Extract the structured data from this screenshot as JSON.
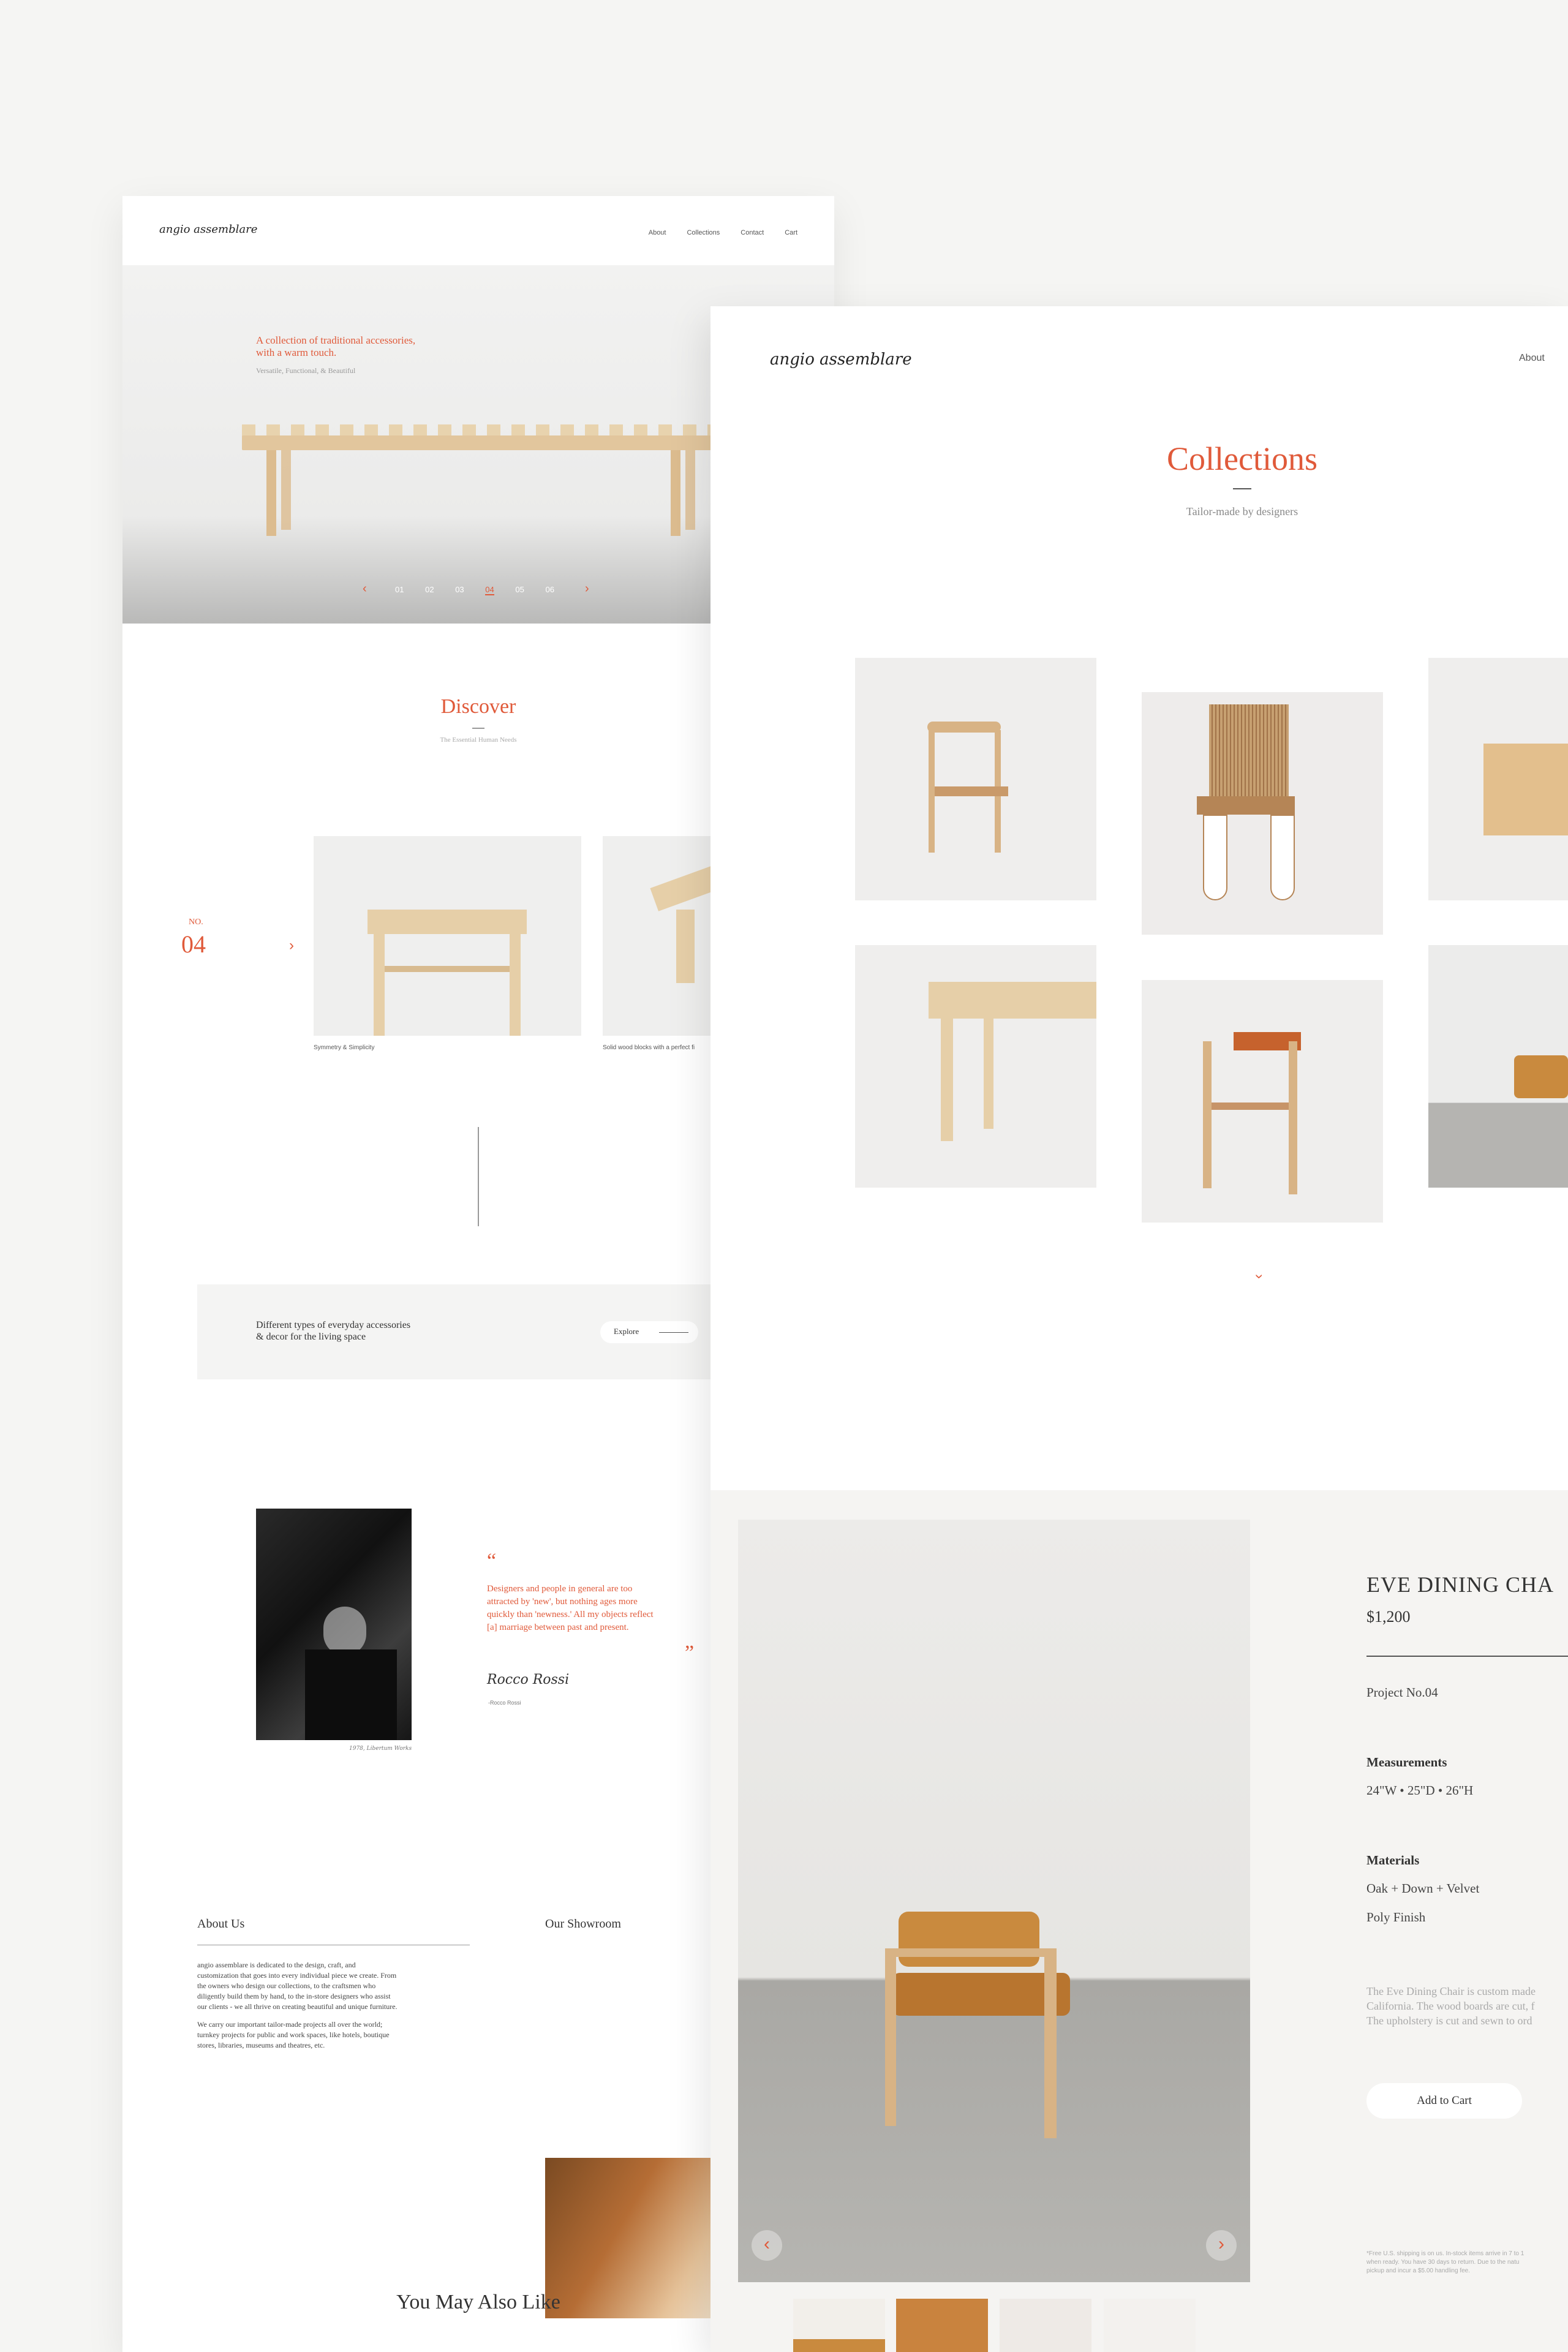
{
  "left": {
    "logo": "angio assemblare",
    "nav": [
      "About",
      "Collections",
      "Contact",
      "Cart"
    ],
    "hero": {
      "headline_line1": "A collection of traditional accessories,",
      "headline_line2": "with a warm touch.",
      "subtitle": "Versatile, Functional, & Beautiful",
      "slides": [
        "01",
        "02",
        "03",
        "04",
        "05",
        "06"
      ],
      "active_slide": "04"
    },
    "discover": {
      "title": "Discover",
      "subtitle": "The Essential Human Needs",
      "no_label": "NO.",
      "number": "04",
      "captions": [
        "Symmetry & Simplicity",
        "Solid wood blocks with a perfect fi"
      ]
    },
    "banner": {
      "line1": "Different types of everyday accessories",
      "line2": "& decor for the living space",
      "button": "Explore"
    },
    "quote": {
      "open": "“",
      "close": "”",
      "line1": "Designers and people in general are too",
      "line2": "attracted by 'new', but nothing ages more",
      "line3": "quickly than 'newness.' All my objects reflect",
      "line4": "[a] marriage between past and present.",
      "signature": "Rocco Rossi",
      "author": "-Rocco Rossi",
      "photo_caption": "1978, Libertum Works"
    },
    "about": {
      "title": "About Us",
      "p1_lines": [
        "angio assemblare is dedicated to the design, craft, and",
        "customization that goes into every individual piece we create. From",
        "the owners who design our collections, to the craftsmen who",
        "diligently build them by hand, to the in-store designers who assist",
        "our clients - we all thrive on creating beautiful and unique furniture."
      ],
      "p2_lines": [
        "We carry our important tailor-made projects all over the world;",
        "turnkey projects for public and work spaces, like hotels, boutique",
        "stores, libraries, museums and theatres, etc."
      ]
    },
    "showroom": {
      "title": "Our Showroom"
    },
    "you_may_like": "You May Also Like"
  },
  "right": {
    "logo": "angio assemblare",
    "nav": [
      "About"
    ],
    "collections_title": "Collections",
    "collections_subtitle": "Tailor-made by designers",
    "product": {
      "name": "EVE DINING CHA",
      "price": "$1,200",
      "project": "Project No.04",
      "measurements_label": "Measurements",
      "measurements": "24\"W • 25\"D • 26\"H",
      "materials_label": "Materials",
      "materials": [
        "Oak + Down + Velvet",
        "Poly Finish"
      ],
      "description_lines": [
        "The Eve Dining Chair is custom made",
        "California. The wood boards are cut, f",
        "The upholstery is cut and sewn to ord"
      ],
      "add_to_cart": "Add to Cart",
      "shipping_lines": [
        "*Free U.S. shipping is on us. In-stock items arrive in 7 to 1",
        "when ready. You have 30 days to return. Due to the natu",
        "pickup and incur a $5.00 handling fee."
      ]
    }
  },
  "colors": {
    "accent": "#e05a3a",
    "wood": "#e2c69d",
    "upholstery": "#c98a3e",
    "background": "#f5f5f3"
  }
}
